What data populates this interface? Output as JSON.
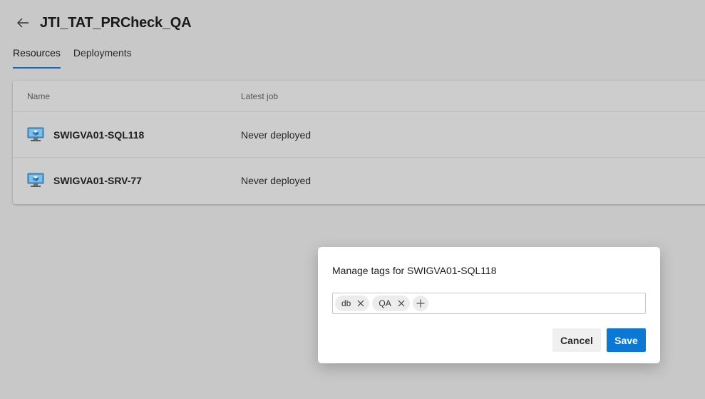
{
  "header": {
    "title": "JTI_TAT_PRCheck_QA",
    "back_icon": "arrow-left-icon"
  },
  "tabs": [
    {
      "label": "Resources",
      "active": true
    },
    {
      "label": "Deployments",
      "active": false
    }
  ],
  "table": {
    "columns": [
      "Name",
      "Latest job"
    ],
    "rows": [
      {
        "name": "SWIGVA01-SQL118",
        "latest_job": "Never deployed",
        "icon": "virtual-machine-icon"
      },
      {
        "name": "SWIGVA01-SRV-77",
        "latest_job": "Never deployed",
        "icon": "virtual-machine-icon"
      }
    ]
  },
  "dialog": {
    "title": "Manage tags for SWIGVA01-SQL118",
    "tags": [
      "db",
      "QA"
    ],
    "cancel_label": "Cancel",
    "save_label": "Save"
  },
  "colors": {
    "accent": "#0a78d4",
    "tab_underline": "#1466b8",
    "overlay": "#c8c8c8"
  }
}
